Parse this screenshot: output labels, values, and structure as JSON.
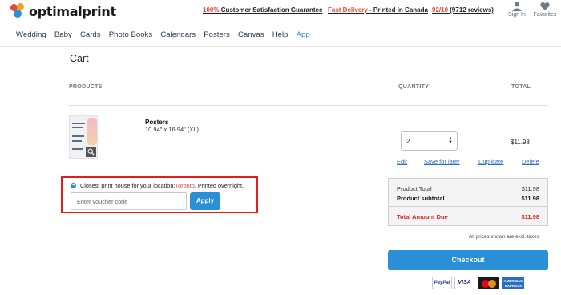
{
  "header": {
    "logo_text": "optimalprint",
    "promo1": {
      "highlight": "100%",
      "text": " Customer Satisfaction Guarantee"
    },
    "promo2": {
      "highlight": "Fast Delivery",
      "text": " - Printed in Canada"
    },
    "promo3": {
      "highlight": "92/10",
      "text": " (9712 reviews)"
    },
    "signin_label": "Sign In",
    "favorites_label": "Favorites",
    "icons": [
      "user-icon",
      "heart-icon"
    ]
  },
  "nav": {
    "items": [
      "Wedding",
      "Baby",
      "Cards",
      "Photo Books",
      "Calendars",
      "Posters",
      "Canvas",
      "Help",
      "App"
    ],
    "active": "App"
  },
  "cart": {
    "title": "Cart",
    "columns": {
      "products": "PRODUCTS",
      "quantity": "QUANTITY",
      "total": "TOTAL"
    },
    "item": {
      "name": "Posters",
      "size": "10.94\" x 16.94\" (XL)",
      "quantity": "2",
      "price": "$11.98",
      "actions": {
        "edit": "Edit",
        "save_later": "Save for later",
        "duplicate": "Duplicate",
        "delete": "Delete"
      }
    }
  },
  "voucher": {
    "location_prefix": "Closest print house for your location: ",
    "city": "Toronto",
    "location_suffix": ". Printed overnight.",
    "placeholder": "Enter voucher code",
    "apply_label": "Apply"
  },
  "summary": {
    "product_total_label": "Product Total",
    "product_total_value": "$11.98",
    "subtotal_label": "Product subtotal",
    "subtotal_value": "$11.98",
    "amount_due_label": "Total Amount Due",
    "amount_due_value": "$11.98"
  },
  "tax_note": "All prices shown are excl. taxes",
  "checkout_label": "Checkout",
  "payment_methods": {
    "paypal": "PayPal",
    "visa": "VISA",
    "mastercard": "MasterCard",
    "amex": "AMERICAN EXPRESS"
  },
  "colors": {
    "accent": "#2a8fd6",
    "brand_red": "#e8453c",
    "highlight_box": "#e31c1c"
  }
}
